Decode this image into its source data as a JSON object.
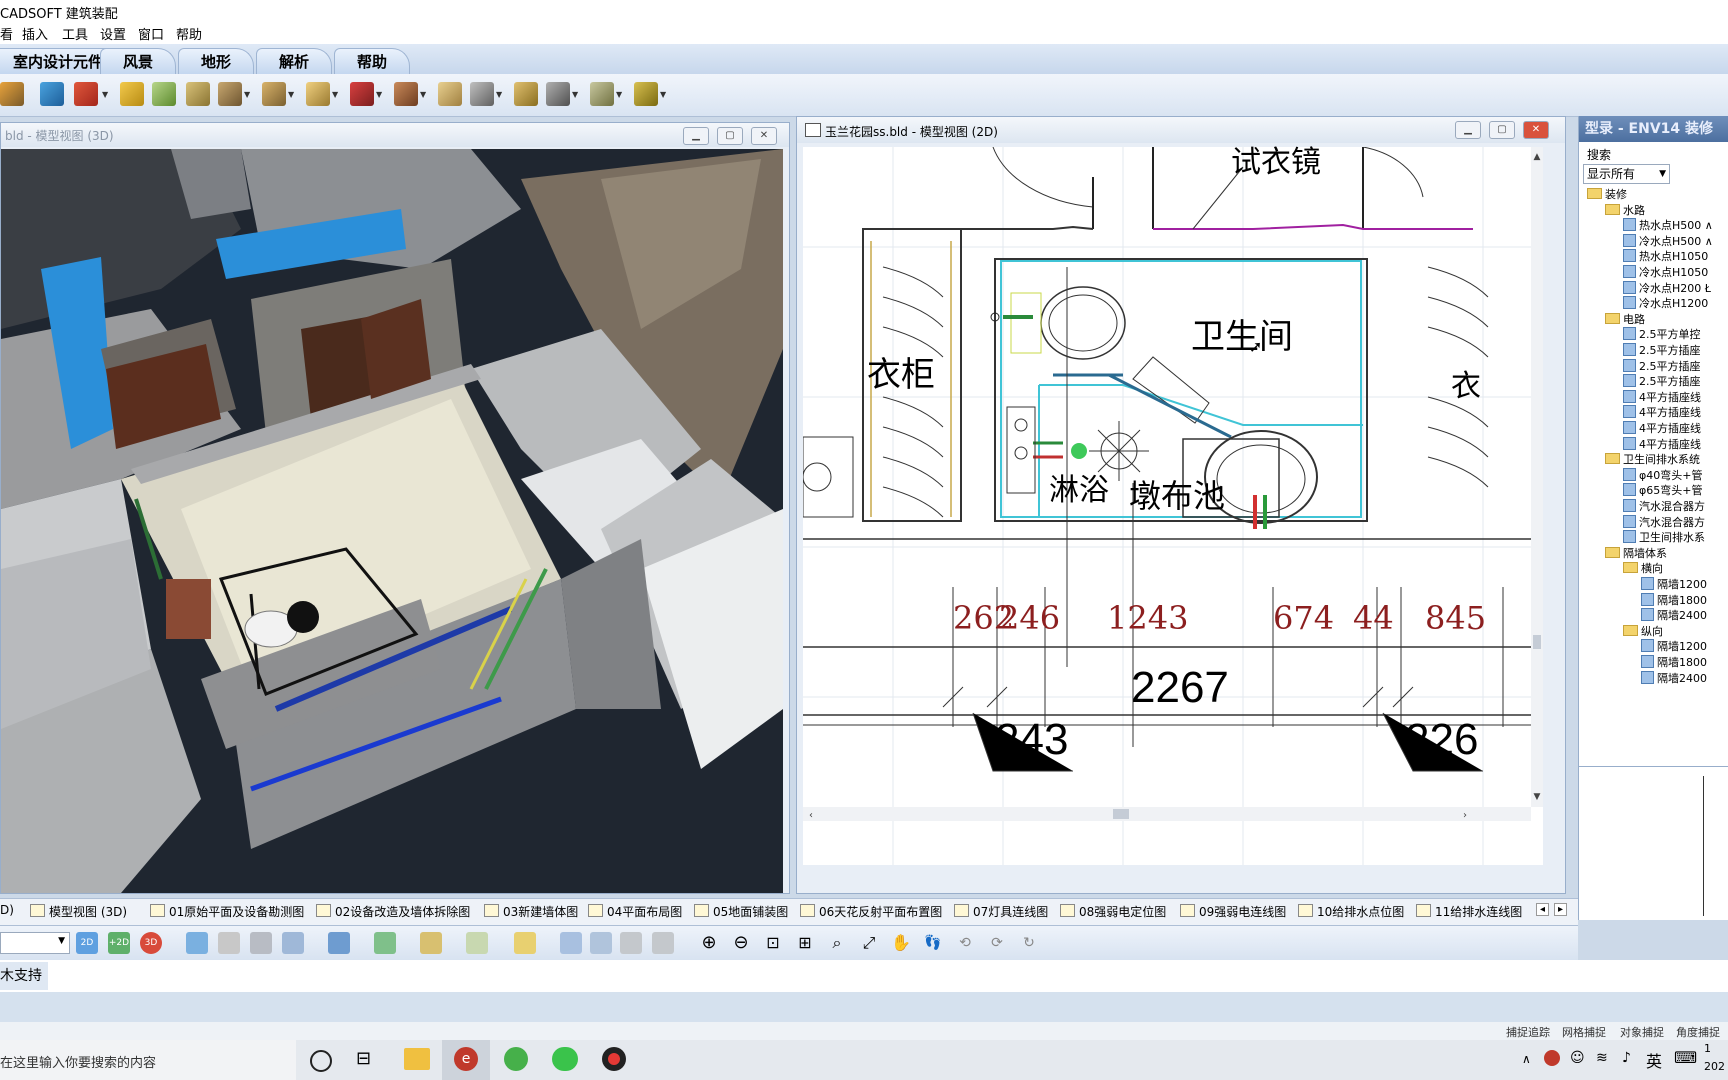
{
  "app": {
    "title": "CADSOFT 建筑装配"
  },
  "menu": {
    "items": [
      "看",
      "插入",
      "工具",
      "设置",
      "窗口",
      "帮助"
    ]
  },
  "ribbon_tabs": [
    "室内设计元件",
    "风景",
    "地形",
    "解析",
    "帮助"
  ],
  "view3d": {
    "title": "bld - 模型视图 (3D)"
  },
  "view2d": {
    "title": "玉兰花园ss.bld - 模型视图 (2D)",
    "rooms": {
      "mirror": "试衣镜",
      "bathroom": "卫生间",
      "wardrobe_left": "衣柜",
      "wardrobe_right": "衣",
      "shower": "淋浴",
      "basin": "墩布池"
    },
    "dims_top": [
      "262",
      "246",
      "1243",
      "674",
      "44",
      "845"
    ],
    "dims_mid": "2267",
    "dims_bottom_left": "243",
    "dims_bottom_right": "226"
  },
  "catalog": {
    "title": "型录 - ENV14 装修",
    "search_label": "搜索",
    "filter_value": "显示所有",
    "tree": [
      {
        "label": "装修",
        "level": 0,
        "kind": "folder"
      },
      {
        "label": "水路",
        "level": 1,
        "kind": "folder"
      },
      {
        "label": "热水点H500 ∧",
        "level": 2,
        "kind": "leaf"
      },
      {
        "label": "冷水点H500 ∧",
        "level": 2,
        "kind": "leaf"
      },
      {
        "label": "热水点H1050",
        "level": 2,
        "kind": "leaf"
      },
      {
        "label": "冷水点H1050",
        "level": 2,
        "kind": "leaf"
      },
      {
        "label": "冷水点H200 Ł",
        "level": 2,
        "kind": "leaf"
      },
      {
        "label": "冷水点H1200",
        "level": 2,
        "kind": "leaf"
      },
      {
        "label": "电路",
        "level": 1,
        "kind": "folder"
      },
      {
        "label": "2.5平方单控",
        "level": 2,
        "kind": "leaf"
      },
      {
        "label": "2.5平方插座",
        "level": 2,
        "kind": "leaf"
      },
      {
        "label": "2.5平方插座",
        "level": 2,
        "kind": "leaf"
      },
      {
        "label": "2.5平方插座",
        "level": 2,
        "kind": "leaf"
      },
      {
        "label": "4平方插座线",
        "level": 2,
        "kind": "leaf"
      },
      {
        "label": "4平方插座线",
        "level": 2,
        "kind": "leaf"
      },
      {
        "label": "4平方插座线",
        "level": 2,
        "kind": "leaf"
      },
      {
        "label": "4平方插座线",
        "level": 2,
        "kind": "leaf"
      },
      {
        "label": "卫生间排水系统",
        "level": 1,
        "kind": "folder"
      },
      {
        "label": "φ40弯头+管",
        "level": 2,
        "kind": "leaf"
      },
      {
        "label": "φ65弯头+管",
        "level": 2,
        "kind": "leaf"
      },
      {
        "label": "汽水混合器方",
        "level": 2,
        "kind": "leaf"
      },
      {
        "label": "汽水混合器方",
        "level": 2,
        "kind": "leaf"
      },
      {
        "label": "卫生间排水系",
        "level": 2,
        "kind": "leaf"
      },
      {
        "label": "隔墙体系",
        "level": 1,
        "kind": "folder"
      },
      {
        "label": "横向",
        "level": 2,
        "kind": "folder"
      },
      {
        "label": "隔墙1200",
        "level": 3,
        "kind": "leaf"
      },
      {
        "label": "隔墙1800",
        "level": 3,
        "kind": "leaf"
      },
      {
        "label": "隔墙2400",
        "level": 3,
        "kind": "leaf"
      },
      {
        "label": "纵向",
        "level": 2,
        "kind": "folder"
      },
      {
        "label": "隔墙1200",
        "level": 3,
        "kind": "leaf"
      },
      {
        "label": "隔墙1800",
        "level": 3,
        "kind": "leaf"
      },
      {
        "label": "隔墙2400",
        "level": 3,
        "kind": "leaf"
      }
    ]
  },
  "bottom_tabs": [
    "D)",
    "模型视图 (3D)",
    "01原始平面及设备勘测图",
    "02设备改造及墙体拆除图",
    "03新建墙体图",
    "04平面布局图",
    "05地面铺装图",
    "06天花反射平面布置图",
    "07灯具连线图",
    "08强弱电定位图",
    "09强弱电连线图",
    "10给排水点位图",
    "11给排水连线图"
  ],
  "command": {
    "text": "木支持"
  },
  "snaps": [
    "捕捉追踪",
    "网格捕捉",
    "对象捕捉",
    "角度捕捉"
  ],
  "taskbar": {
    "search_placeholder": "在这里输入你要搜索的内容",
    "ime": "英",
    "time": "1",
    "date": "202"
  }
}
